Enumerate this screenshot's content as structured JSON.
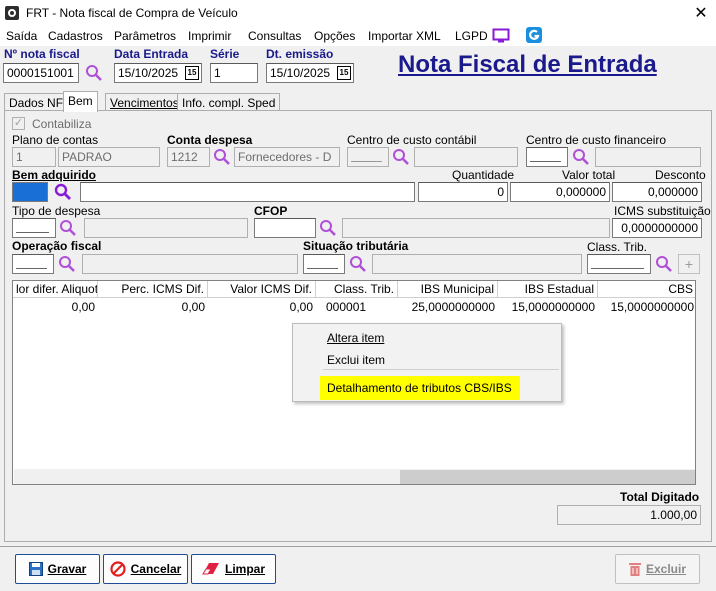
{
  "window": {
    "title": "FRT - Nota fiscal de Compra de Veículo",
    "close_glyph": "✕"
  },
  "menu": [
    "Saída",
    "Cadastros",
    "Parâmetros",
    "Imprimir",
    "Consultas",
    "Opções",
    "Importar XML",
    "LGPD"
  ],
  "header": {
    "nota_fiscal_label": "Nº nota fiscal",
    "nota_fiscal_value": "0000151001",
    "data_entrada_label": "Data Entrada",
    "data_entrada_value": "15/10/2025",
    "serie_label": "Série",
    "serie_value": "1",
    "dt_emissao_label": "Dt. emissão",
    "dt_emissao_value": "15/10/2025",
    "calendar_glyph": "15",
    "page_title": "Nota Fiscal de Entrada"
  },
  "tabs": [
    "Dados NF",
    "Bem",
    "Vencimentos",
    "Info. compl. Sped"
  ],
  "form": {
    "contabiliza_label": "Contabiliza",
    "check_glyph": "✓",
    "plano_contas_label": "Plano de contas",
    "plano_contas_code": "1",
    "plano_contas_name": "PADRAO",
    "conta_despesa_label": "Conta despesa",
    "conta_despesa_code": "1212",
    "conta_despesa_name": "Fornecedores - D",
    "centro_custo_contabil_label": "Centro de custo contábil",
    "centro_custo_financeiro_label": "Centro de custo financeiro",
    "bem_adquirido_label": "Bem adquirido",
    "quantidade_label": "Quantidade",
    "quantidade_value": "0",
    "valor_total_label": "Valor total",
    "valor_total_value": "0,000000",
    "desconto_label": "Desconto",
    "desconto_value": "0,000000",
    "tipo_despesa_label": "Tipo de despesa",
    "cfop_label": "CFOP",
    "icms_subst_label": "ICMS substituição",
    "icms_subst_value": "0,0000000000",
    "operacao_fiscal_label": "Operação fiscal",
    "situacao_tributaria_label": "Situação tributária",
    "class_trib_label": "Class. Trib.",
    "plus_glyph": "+"
  },
  "grid": {
    "headers": [
      "lor difer. Aliquota",
      "Perc. ICMS Dif.",
      "Valor ICMS Dif.",
      "Class. Trib.",
      "IBS Municipal",
      "IBS Estadual",
      "CBS"
    ],
    "rows": [
      [
        "0,00",
        "0,00",
        "0,00",
        "000001",
        "25,0000000000",
        "15,0000000000",
        "15,0000000000"
      ]
    ]
  },
  "context_menu": {
    "items": [
      "Altera item",
      "Exclui item",
      "Detalhamento de tributos CBS/IBS"
    ],
    "highlight_color": "#ffff00"
  },
  "totals": {
    "label": "Total Digitado",
    "value": "1.000,00"
  },
  "buttons": {
    "gravar": "Gravar",
    "cancelar": "Cancelar",
    "limpar": "Limpar",
    "excluir": "Excluir"
  },
  "colors": {
    "title_blue": "#1a1a8c",
    "label_blue": "#1a1a8c",
    "button_border": "#1f4e96"
  }
}
